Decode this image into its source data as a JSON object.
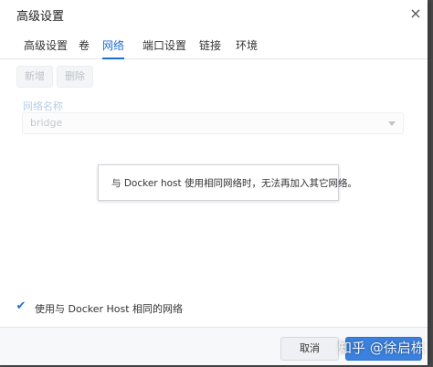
{
  "dialog": {
    "title": "高级设置",
    "close_glyph": "×"
  },
  "tabs": [
    {
      "label": "高级设置",
      "active": false
    },
    {
      "label": "卷",
      "active": false
    },
    {
      "label": "网络",
      "active": true
    },
    {
      "label": "端口设置",
      "active": false
    },
    {
      "label": "链接",
      "active": false
    },
    {
      "label": "环境",
      "active": false
    }
  ],
  "toolbar": {
    "add_label": "新增",
    "delete_label": "删除"
  },
  "network": {
    "field_label": "网络名称",
    "selected_value": "bridge"
  },
  "message": {
    "text": "与 Docker host 使用相同网络时，无法再加入其它网络。"
  },
  "host_network": {
    "checked": true,
    "check_glyph": "✔",
    "label": "使用与 Docker Host 相同的网络"
  },
  "footer": {
    "cancel_label": "取消"
  },
  "watermark": {
    "text": "知乎 @徐启栋"
  },
  "colors": {
    "accent": "#1f6fd0",
    "apply_button": "#3b82e0"
  }
}
